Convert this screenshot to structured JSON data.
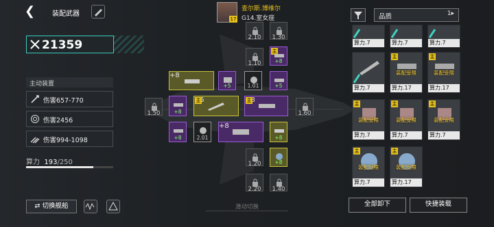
{
  "header": {
    "title": "装配武器"
  },
  "power": {
    "value": "21359"
  },
  "active_equipment": {
    "label": "主动装置",
    "stats": [
      {
        "icon": "missile-icon",
        "text": "伤害657-770"
      },
      {
        "icon": "target-icon",
        "text": "伤害2456"
      },
      {
        "icon": "multi-missile-icon",
        "text": "伤害994-1098"
      }
    ]
  },
  "compute": {
    "label": "算力",
    "used": "193",
    "total": "/250",
    "ratio": 0.772
  },
  "bottom": {
    "switch_ship": "切换舰船",
    "swipe_hint": "滑动切换"
  },
  "pilot": {
    "name": "查尔斯.博维尔",
    "code": "G14.室女座",
    "level": "17"
  },
  "slots": {
    "top1": "2.10",
    "top2": "1.30",
    "r2": "1.10",
    "mid_left": "1.50",
    "mid_right": "1.60",
    "dark1": "1.01",
    "dark2": "2.01",
    "b1": "1.20",
    "b2": "2.20",
    "b3": "1.40",
    "plus8": "+8",
    "plus5": "+5",
    "main": "主"
  },
  "inventory": {
    "filter_label": "品质",
    "cards": [
      {
        "label": "算力.7"
      },
      {
        "label": "算力.7"
      },
      {
        "label": "算力.7"
      },
      {
        "label": "算力.7"
      },
      {
        "label": "算力.17",
        "warn": "装配受限"
      },
      {
        "label": "算力.17",
        "warn": "装配受限"
      },
      {
        "label": "算力.7",
        "warn": "装配受限"
      },
      {
        "label": "算力.7",
        "warn": "装配受限"
      },
      {
        "label": "算力.7",
        "warn": "装配受限"
      },
      {
        "label": "算力.7",
        "warn": "装配受限"
      },
      {
        "label": "算力.17",
        "warn": "装配受限"
      }
    ],
    "unload_all": "全部卸下",
    "quick_equip": "快捷装载"
  },
  "colors": {
    "accent_cyan": "#3fd0c0",
    "purple": "#9a5ad6",
    "yellow": "#c8c23a",
    "gold": "#e8c21a",
    "warn": "#ffd23a"
  }
}
